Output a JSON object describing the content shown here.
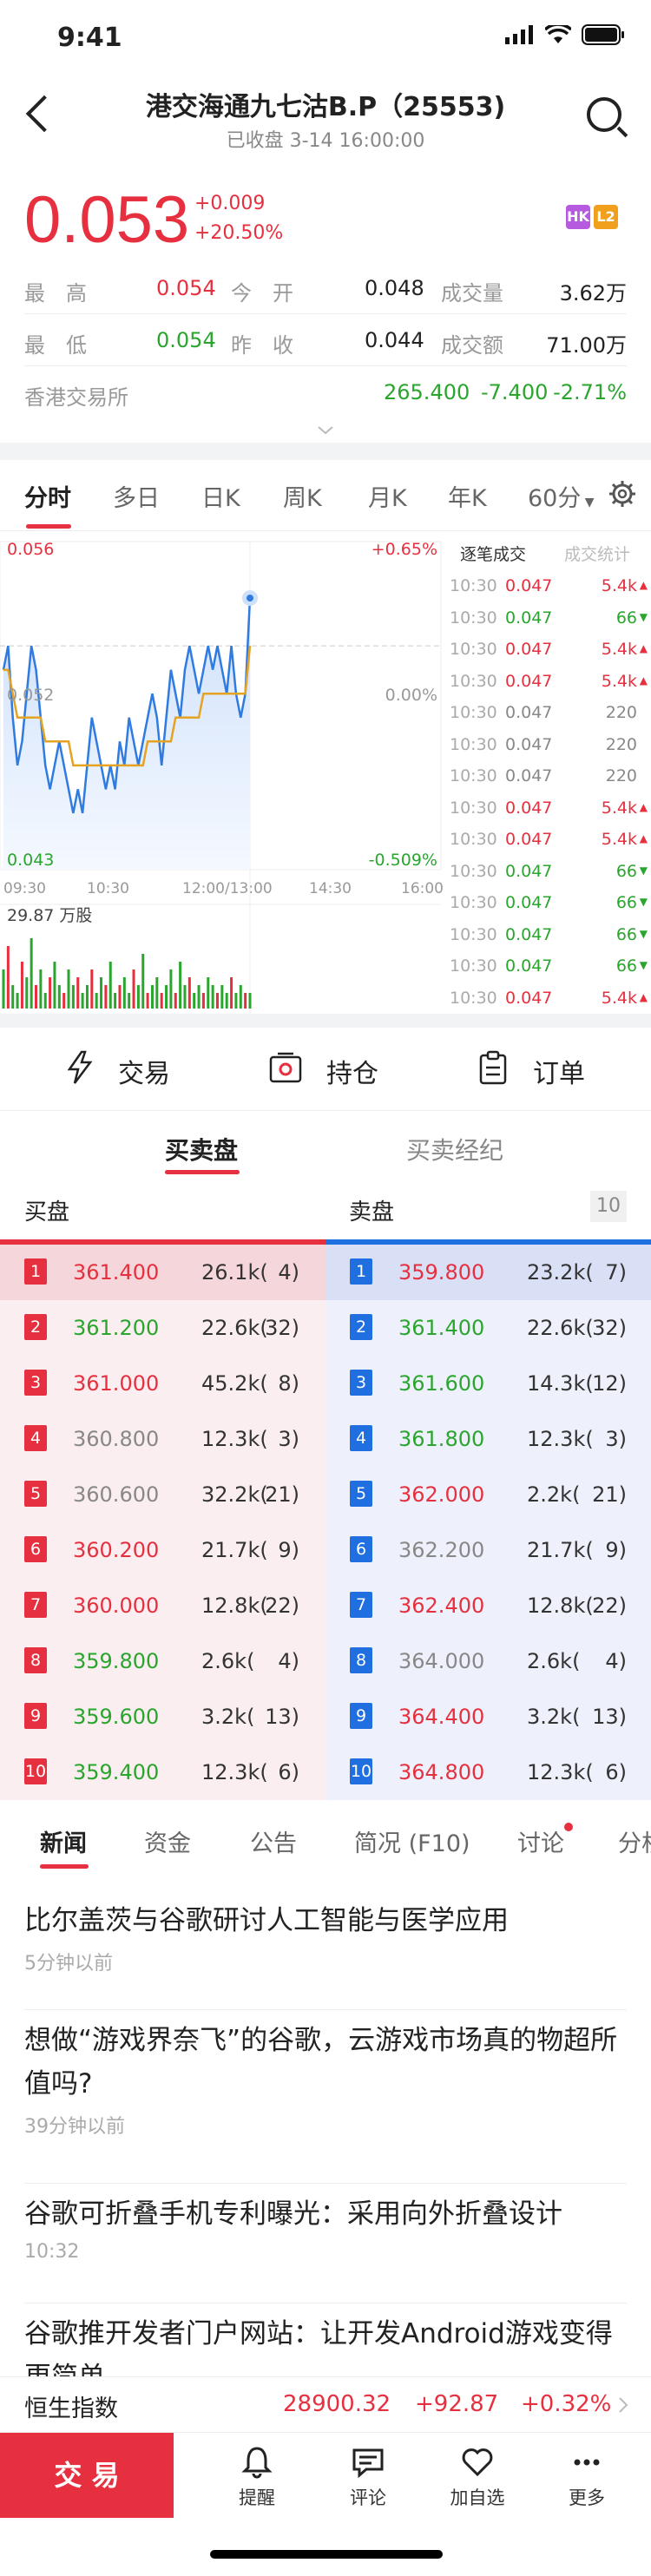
{
  "status": {
    "time": "9:41"
  },
  "nav": {
    "title": "港交海通九七沽B.P（25553)",
    "subtitle": "已收盘 3-14 16:00:00"
  },
  "quote": {
    "price": "0.053",
    "change": "+0.009",
    "change_pct": "+20.50%",
    "badge_hk": "HK",
    "badge_l2": "L2",
    "high_label": "最　高",
    "high": "0.054",
    "open_label": "今　开",
    "open": "0.048",
    "vol_label": "成交量",
    "vol": "3.62万",
    "low_label": "最　低",
    "low": "0.054",
    "prev_label": "昨　收",
    "prev": "0.044",
    "amt_label": "成交额",
    "amt": "71.00万",
    "exch_label": "香港交易所",
    "exch_price": "265.400",
    "exch_change": "-7.400",
    "exch_pct": "-2.71%"
  },
  "chart_tabs": [
    "分时",
    "多日",
    "日K",
    "周K",
    "月K",
    "年K",
    "60分"
  ],
  "chart_data": {
    "type": "line",
    "y_high": "0.056",
    "y_mid": "0.052",
    "y_low": "0.043",
    "pct_high": "+0.65%",
    "pct_mid": "0.00%",
    "pct_low": "-0.509%",
    "x_labels": [
      "09:30",
      "10:30",
      "12:00/13:00",
      "14:30",
      "16:00"
    ],
    "vol_label": "29.87 万股",
    "series": [
      {
        "values": [
          0.051,
          0.052,
          0.049,
          0.047,
          0.048,
          0.05,
          0.052,
          0.051,
          0.049,
          0.047,
          0.046,
          0.047,
          0.048,
          0.047,
          0.046,
          0.045,
          0.046,
          0.045,
          0.047,
          0.049,
          0.048,
          0.047,
          0.046,
          0.047,
          0.046,
          0.048,
          0.047,
          0.049,
          0.048,
          0.047,
          0.048,
          0.049,
          0.05,
          0.049,
          0.047,
          0.049,
          0.051,
          0.05,
          0.049,
          0.051,
          0.052,
          0.051,
          0.05,
          0.051,
          0.052,
          0.051,
          0.052,
          0.051,
          0.05,
          0.052,
          0.05,
          0.049,
          0.05,
          0.054
        ]
      },
      {
        "values": [
          0.051,
          0.051,
          0.05,
          0.049,
          0.049,
          0.049,
          0.049,
          0.049,
          0.049,
          0.048,
          0.048,
          0.048,
          0.048,
          0.048,
          0.048,
          0.047,
          0.047,
          0.047,
          0.047,
          0.047,
          0.047,
          0.047,
          0.047,
          0.047,
          0.047,
          0.047,
          0.047,
          0.047,
          0.047,
          0.047,
          0.047,
          0.048,
          0.048,
          0.048,
          0.048,
          0.048,
          0.048,
          0.049,
          0.049,
          0.049,
          0.049,
          0.049,
          0.049,
          0.05,
          0.05,
          0.05,
          0.05,
          0.05,
          0.05,
          0.05,
          0.05,
          0.05,
          0.05,
          0.052
        ]
      }
    ],
    "volumes": [
      0.5,
      0.8,
      0.3,
      0.2,
      0.6,
      0.4,
      0.9,
      0.3,
      0.5,
      0.2,
      0.4,
      0.6,
      0.3,
      0.2,
      0.5,
      0.3,
      0.4,
      0.2,
      0.3,
      0.5,
      0.2,
      0.4,
      0.3,
      0.6,
      0.2,
      0.3,
      0.4,
      0.2,
      0.5,
      0.3,
      0.7,
      0.2,
      0.3,
      0.4,
      0.2,
      0.3,
      0.5,
      0.2,
      0.6,
      0.3,
      0.4,
      0.2,
      0.3,
      0.2,
      0.4,
      0.3,
      0.2,
      0.3,
      0.2,
      0.4,
      0.2,
      0.3,
      0.2,
      0.2
    ]
  },
  "trade_tabs": {
    "left": "逐笔成交",
    "right": "成交统计"
  },
  "trades": [
    {
      "t": "10:30",
      "p": "0.047",
      "v": "5.4k",
      "c": "red"
    },
    {
      "t": "10:30",
      "p": "0.047",
      "v": "66",
      "c": "green"
    },
    {
      "t": "10:30",
      "p": "0.047",
      "v": "5.4k",
      "c": "red"
    },
    {
      "t": "10:30",
      "p": "0.047",
      "v": "5.4k",
      "c": "red"
    },
    {
      "t": "10:30",
      "p": "0.047",
      "v": "220",
      "c": "grey"
    },
    {
      "t": "10:30",
      "p": "0.047",
      "v": "220",
      "c": "grey"
    },
    {
      "t": "10:30",
      "p": "0.047",
      "v": "220",
      "c": "grey"
    },
    {
      "t": "10:30",
      "p": "0.047",
      "v": "5.4k",
      "c": "red"
    },
    {
      "t": "10:30",
      "p": "0.047",
      "v": "5.4k",
      "c": "red"
    },
    {
      "t": "10:30",
      "p": "0.047",
      "v": "66",
      "c": "green"
    },
    {
      "t": "10:30",
      "p": "0.047",
      "v": "66",
      "c": "green"
    },
    {
      "t": "10:30",
      "p": "0.047",
      "v": "66",
      "c": "green"
    },
    {
      "t": "10:30",
      "p": "0.047",
      "v": "66",
      "c": "green"
    },
    {
      "t": "10:30",
      "p": "0.047",
      "v": "5.4k",
      "c": "red"
    }
  ],
  "actions": {
    "trade": "交易",
    "position": "持仓",
    "order": "订单"
  },
  "ob_tabs": {
    "left": "买卖盘",
    "right": "买卖经纪"
  },
  "orderbook": {
    "bid_title": "买盘",
    "ask_title": "卖盘",
    "depth": "10",
    "bids": [
      {
        "n": "1",
        "p": "361.400",
        "v": "26.1k(",
        "c": "4)",
        "col": "red"
      },
      {
        "n": "2",
        "p": "361.200",
        "v": "22.6k(",
        "c": "32)",
        "col": "green"
      },
      {
        "n": "3",
        "p": "361.000",
        "v": "45.2k(",
        "c": "8)",
        "col": "red"
      },
      {
        "n": "4",
        "p": "360.800",
        "v": "12.3k(",
        "c": "3)",
        "col": "grey"
      },
      {
        "n": "5",
        "p": "360.600",
        "v": "32.2k(",
        "c": "21)",
        "col": "grey"
      },
      {
        "n": "6",
        "p": "360.200",
        "v": "21.7k(",
        "c": "9)",
        "col": "red"
      },
      {
        "n": "7",
        "p": "360.000",
        "v": "12.8k(",
        "c": "22)",
        "col": "red"
      },
      {
        "n": "8",
        "p": "359.800",
        "v": "2.6k(",
        "c": "4)",
        "col": "green"
      },
      {
        "n": "9",
        "p": "359.600",
        "v": "3.2k(",
        "c": "13)",
        "col": "green"
      },
      {
        "n": "10",
        "p": "359.400",
        "v": "12.3k(",
        "c": "6)",
        "col": "green"
      }
    ],
    "asks": [
      {
        "n": "1",
        "p": "359.800",
        "v": "23.2k(",
        "c": "7)",
        "col": "red"
      },
      {
        "n": "2",
        "p": "361.400",
        "v": "22.6k(",
        "c": "32)",
        "col": "green"
      },
      {
        "n": "3",
        "p": "361.600",
        "v": "14.3k(",
        "c": "12)",
        "col": "green"
      },
      {
        "n": "4",
        "p": "361.800",
        "v": "12.3k(",
        "c": "3)",
        "col": "green"
      },
      {
        "n": "5",
        "p": "362.000",
        "v": "2.2k(",
        "c": "21)",
        "col": "red"
      },
      {
        "n": "6",
        "p": "362.200",
        "v": "21.7k(",
        "c": "9)",
        "col": "grey"
      },
      {
        "n": "7",
        "p": "362.400",
        "v": "12.8k(",
        "c": "22)",
        "col": "red"
      },
      {
        "n": "8",
        "p": "364.000",
        "v": "2.6k(",
        "c": "4)",
        "col": "grey"
      },
      {
        "n": "9",
        "p": "364.400",
        "v": "3.2k(",
        "c": "13)",
        "col": "red"
      },
      {
        "n": "10",
        "p": "364.800",
        "v": "12.3k(",
        "c": "6)",
        "col": "red"
      }
    ]
  },
  "news_tabs": [
    "新闻",
    "资金",
    "公告",
    "简况 (F10)",
    "讨论",
    "分析"
  ],
  "news": [
    {
      "title": "比尔盖茨与谷歌研讨人工智能与医学应用",
      "time": "5分钟以前"
    },
    {
      "title": "想做“游戏界奈飞”的谷歌，云游戏市场真的物超所值吗?",
      "time": "39分钟以前"
    },
    {
      "title": "谷歌可折叠手机专利曝光：采用向外折叠设计",
      "time": "10:32"
    },
    {
      "title": "谷歌推开发者门户网站：让开发Android游戏变得更简单",
      "time": ""
    }
  ],
  "index": {
    "name": "恒生指数",
    "value": "28900.32",
    "change": "+92.87",
    "pct": "+0.32%"
  },
  "bottom": {
    "trade": "交 易",
    "remind": "提醒",
    "comment": "评论",
    "watch": "加自选",
    "more": "更多"
  }
}
